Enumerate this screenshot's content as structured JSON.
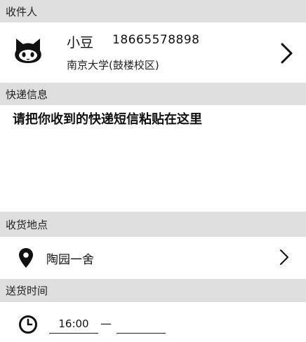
{
  "recipient_section": {
    "header": "收件人",
    "avatar_icon": "github-octocat-icon",
    "name": "小豆",
    "phone": "18665578898",
    "address": "南京大学(鼓楼校区)",
    "chevron_icon": "chevron-right-icon"
  },
  "express_section": {
    "header": "快递信息",
    "paste_placeholder": "请把你收到的快递短信粘贴在这里"
  },
  "place_section": {
    "header": "收货地点",
    "pin_icon": "location-pin-icon",
    "place": "陶园一舍",
    "chevron_icon": "chevron-right-icon"
  },
  "time_section": {
    "header": "送货时间",
    "clock_icon": "clock-icon",
    "start_time": "16:00",
    "separator": "—",
    "end_time": ""
  }
}
